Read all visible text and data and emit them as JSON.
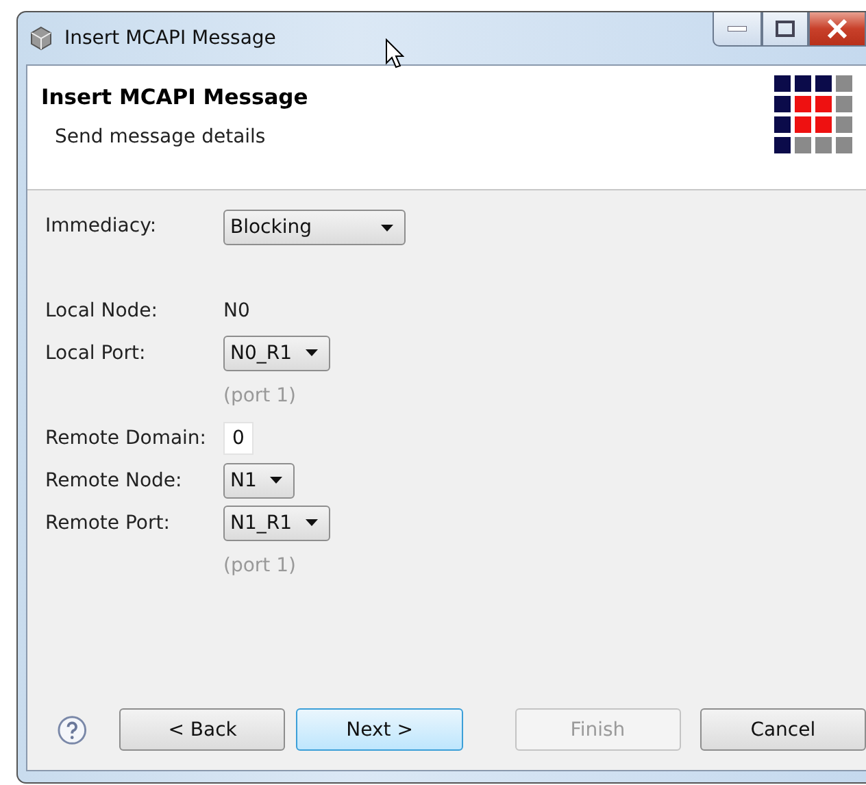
{
  "window": {
    "title": "Insert MCAPI Message"
  },
  "header": {
    "title": "Insert MCAPI Message",
    "subtitle": "Send message details"
  },
  "immediacy": {
    "label": "Immediacy:",
    "value": "Blocking"
  },
  "fields": [
    {
      "kind": "text",
      "label": "Local Node:",
      "value": "N0"
    },
    {
      "kind": "dropdown",
      "label": "Local Port:",
      "value": "N0_R1",
      "hint": "(port 1)"
    },
    {
      "kind": "input",
      "label": "Remote Domain:",
      "value": "0"
    },
    {
      "kind": "dropdown",
      "label": "Remote Node:",
      "value": "N1"
    },
    {
      "kind": "dropdown",
      "label": "Remote Port:",
      "value": "N1_R1",
      "hint": "(port 1)"
    }
  ],
  "buttons": [
    {
      "label": "< Back",
      "disabled": false,
      "default": false
    },
    {
      "label": "Next >",
      "disabled": false,
      "default": true
    },
    {
      "label": "Finish",
      "disabled": true,
      "default": false
    },
    {
      "label": "Cancel",
      "disabled": false,
      "default": false
    }
  ]
}
